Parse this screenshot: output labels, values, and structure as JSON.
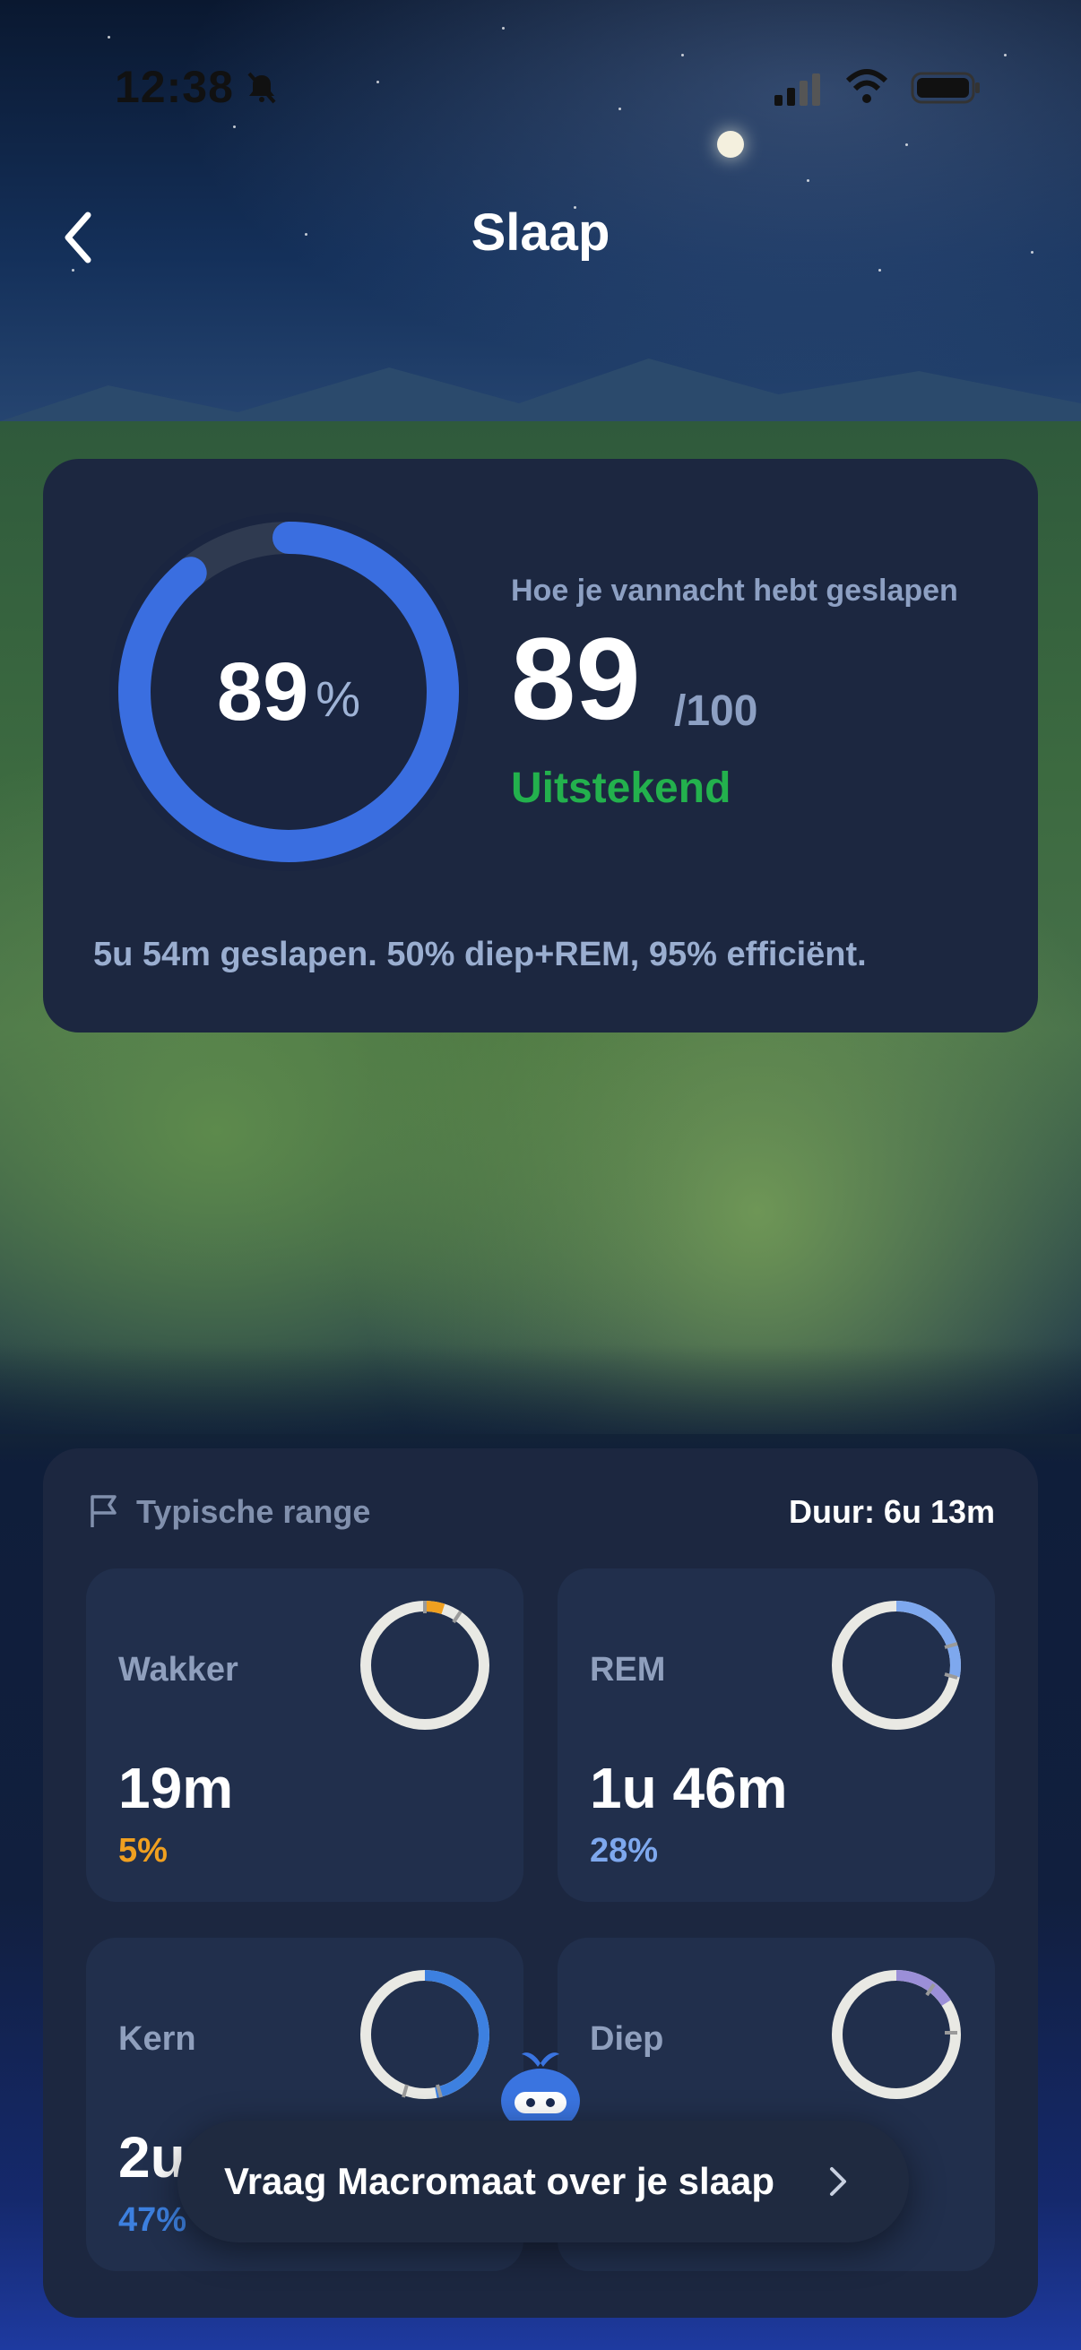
{
  "status_bar": {
    "time": "12:38"
  },
  "header": {
    "title": "Slaap"
  },
  "score": {
    "ring_value": "89",
    "ring_unit": "%",
    "ring_fraction": 0.89,
    "label": "Hoe je vannacht hebt geslapen",
    "value": "89",
    "max": "/100",
    "rating": "Uitstekend",
    "summary": "5u 54m geslapen. 50% diep+REM, 95% efficiënt."
  },
  "stages": {
    "range_label": "Typische range",
    "duration": "Duur: 6u 13m",
    "items": [
      {
        "name": "Wakker",
        "duration": "19m",
        "percent": "5%",
        "color": "#f0a020",
        "fraction": 0.05
      },
      {
        "name": "REM",
        "duration": "1u 46m",
        "percent": "28%",
        "color": "#7ea8ee",
        "fraction": 0.28
      },
      {
        "name": "Kern",
        "duration": "2u",
        "percent": "47%",
        "color": "#3d80e0",
        "fraction": 0.47
      },
      {
        "name": "Diep",
        "duration": "",
        "percent": "",
        "color": "#9b8fd8",
        "fraction": 0.16
      }
    ]
  },
  "ask_button": {
    "label": "Vraag Macromaat over je slaap"
  },
  "colors": {
    "card": "#1c2740",
    "tile": "#212f4c",
    "accent_blue": "#3a6ee0",
    "rating_green": "#23b14d"
  }
}
